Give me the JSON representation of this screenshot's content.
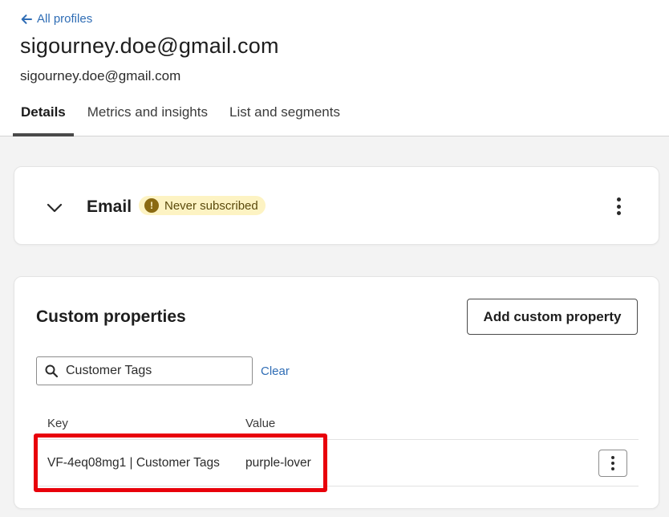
{
  "header": {
    "back_label": "All profiles",
    "title": "sigourney.doe@gmail.com",
    "subtitle": "sigourney.doe@gmail.com",
    "tabs": [
      {
        "label": "Details",
        "active": true
      },
      {
        "label": "Metrics and insights",
        "active": false
      },
      {
        "label": "List and segments",
        "active": false
      }
    ]
  },
  "email_card": {
    "label": "Email",
    "badge": "Never subscribed",
    "badge_icon": "exclamation-icon",
    "badge_glyph": "!"
  },
  "custom_properties": {
    "title": "Custom properties",
    "add_button": "Add custom property",
    "search": {
      "value": "Customer Tags",
      "placeholder": ""
    },
    "clear_label": "Clear",
    "columns": {
      "key": "Key",
      "value": "Value"
    },
    "rows": [
      {
        "key": "VF-4eq08mg1 | Customer Tags",
        "value": "purple-lover"
      }
    ]
  },
  "colors": {
    "link": "#2f6db5",
    "badge_bg": "#fdf3c3",
    "badge_icon": "#8a6a12",
    "highlight": "#e8000b"
  }
}
